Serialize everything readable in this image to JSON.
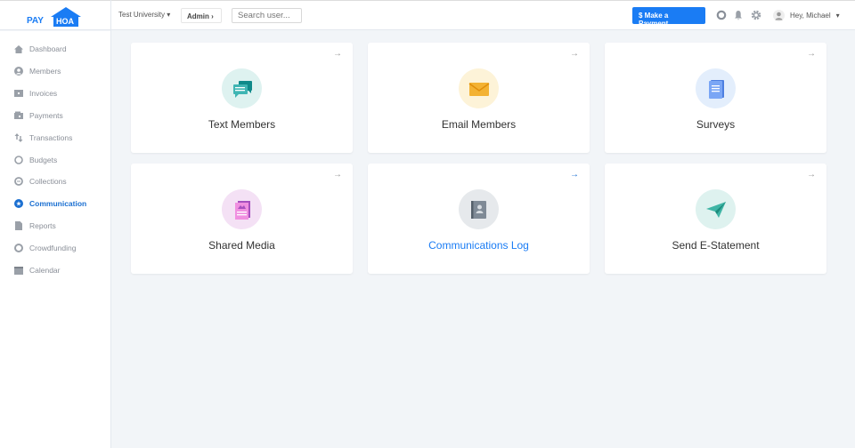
{
  "header": {
    "logo_text": "PAY HOA",
    "logo_pay": "PAY",
    "logo_hoa": "HOA",
    "org": "Test University",
    "admin": "Admin ›",
    "search_placeholder": "Search user...",
    "pay_button": "$  Make a Payment",
    "user_greeting": "Hey, Michael"
  },
  "sidebar": {
    "items": [
      {
        "label": "Dashboard",
        "icon": "home-icon"
      },
      {
        "label": "Members",
        "icon": "user-icon"
      },
      {
        "label": "Invoices",
        "icon": "invoice-icon"
      },
      {
        "label": "Payments",
        "icon": "wallet-icon"
      },
      {
        "label": "Transactions",
        "icon": "arrows-icon"
      },
      {
        "label": "Budgets",
        "icon": "circle-icon"
      },
      {
        "label": "Collections",
        "icon": "collections-icon"
      },
      {
        "label": "Communication",
        "icon": "star-icon",
        "active": true
      },
      {
        "label": "Reports",
        "icon": "file-icon"
      },
      {
        "label": "Crowdfunding",
        "icon": "ring-icon"
      },
      {
        "label": "Calendar",
        "icon": "calendar-icon"
      }
    ]
  },
  "cards": [
    {
      "label": "Text Members",
      "icon": "chat-icon",
      "bg": "#def2f0"
    },
    {
      "label": "Email Members",
      "icon": "envelope-icon",
      "bg": "#fdf3d8"
    },
    {
      "label": "Surveys",
      "icon": "clipboard-icon",
      "bg": "#e3eefc"
    },
    {
      "label": "Shared Media",
      "icon": "media-icon",
      "bg": "#f4e1f5"
    },
    {
      "label": "Communications Log",
      "icon": "contact-book-icon",
      "bg": "#e6e9ec",
      "active": true
    },
    {
      "label": "Send E-Statement",
      "icon": "paper-plane-icon",
      "bg": "#def2ef"
    }
  ],
  "colors": {
    "accent": "#1a7cf4",
    "active_nav": "#1a6fd1"
  }
}
